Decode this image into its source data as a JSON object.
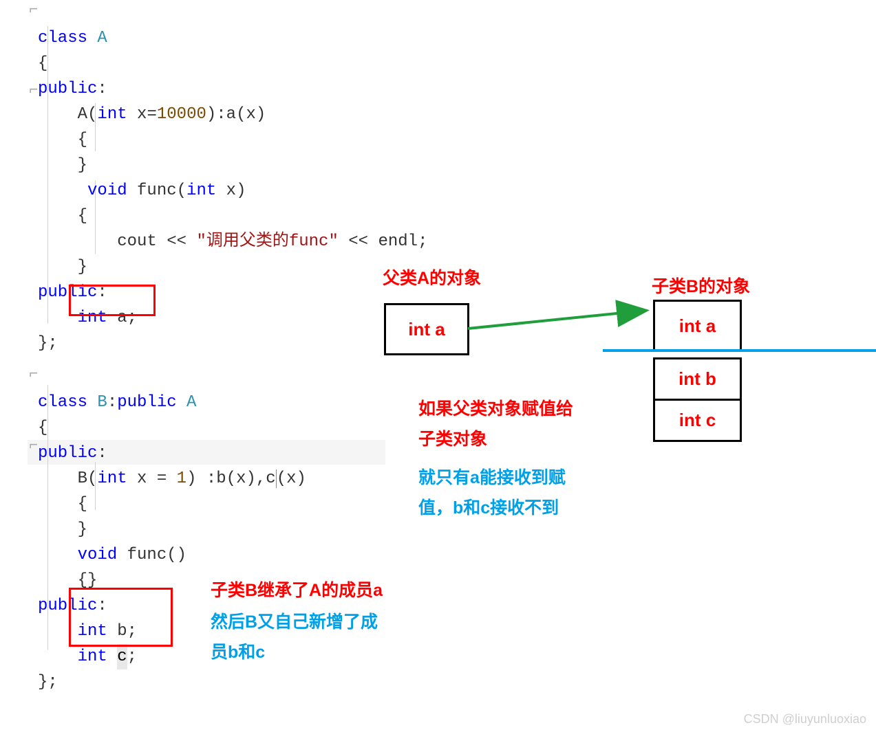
{
  "codeA": {
    "l1_class": "class",
    "l1_name": " A",
    "l2": "{",
    "l3_public": "public",
    "l3_colon": ":",
    "l4_pre": "    A(",
    "l4_int": "int",
    "l4_mid": " x=",
    "l4_num": "10000",
    "l4_post": "):a(x)",
    "l5": "    {",
    "l6": "    }",
    "l7_pre": "     ",
    "l7_void": "void",
    "l7_mid": " func(",
    "l7_int": "int",
    "l7_post": " x)",
    "l8": "    {",
    "l9_pre": "        cout << ",
    "l9_str": "\"调用父类的func\"",
    "l9_post": " << endl;",
    "l10": "    }",
    "l11_public": "public",
    "l11_colon": ":",
    "l12_pre": "    ",
    "l12_int": "int",
    "l12_post": " a;",
    "l13": "};"
  },
  "codeB": {
    "l1_class": "class",
    "l1_name": " B",
    "l1_colon": ":",
    "l1_public": "public",
    "l1_A": " A",
    "l2": "{",
    "l3_public": "public",
    "l3_colon": ":",
    "l4_pre": "    B(",
    "l4_int": "int",
    "l4_mid": " x = ",
    "l4_num": "1",
    "l4_post1": ") :b(x),",
    "l4_c": "c",
    "l4_post2": "(x)",
    "l5": "    {",
    "l6": "    }",
    "l7_pre": "    ",
    "l7_void": "void",
    "l7_post": " func()",
    "l8": "    {}",
    "l9_public": "public",
    "l9_colon": ":",
    "l10_pre": "    ",
    "l10_int": "int",
    "l10_post": " b;",
    "l11_pre": "    ",
    "l11_int": "int",
    "l11_c": "c",
    "l11_post": ";",
    "l12": "};"
  },
  "boxes": {
    "parentTitle": "父类A的对象",
    "childTitle": "子类B的对象",
    "int_a": "int a",
    "int_b": "int b",
    "int_c": "int c"
  },
  "anno1": {
    "line1": "如果父类对象赋值给",
    "line2": "子类对象"
  },
  "anno2": {
    "line1": "就只有a能接收到赋",
    "line2": "值，b和c接收不到"
  },
  "anno3": {
    "line1": "子类B继承了A的成员a"
  },
  "anno4": {
    "line1": "然后B又自己新增了成",
    "line2": "员b和c"
  },
  "watermark": "CSDN @liuyunluoxiao"
}
